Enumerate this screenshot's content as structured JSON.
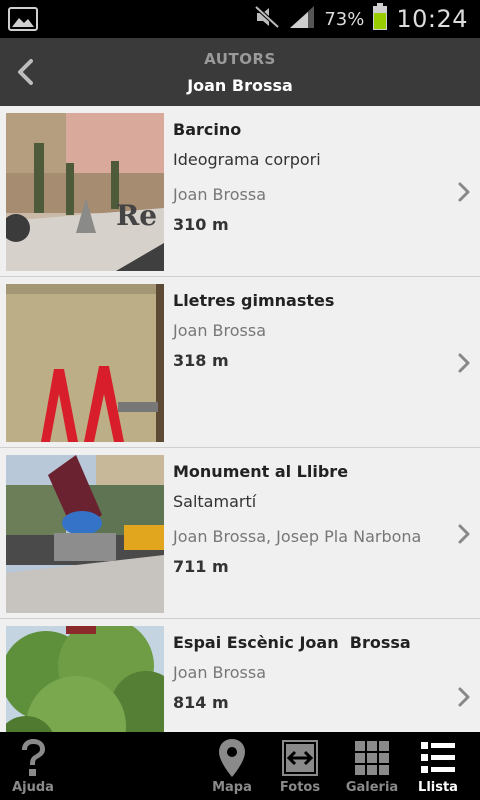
{
  "status_bar": {
    "battery_percent": "73%",
    "time": "10:24",
    "icons": [
      "image-icon",
      "mute-icon",
      "signal-icon",
      "battery-icon"
    ]
  },
  "header": {
    "subtitle": "AUTORS",
    "title": "Joan Brossa",
    "back_icon": "chevron-left-icon"
  },
  "items": [
    {
      "title": "Barcino",
      "subtitle": "Ideograma corpori",
      "author": "Joan Brossa",
      "distance": "310 m"
    },
    {
      "title": "Lletres gimnastes",
      "subtitle": "",
      "author": "Joan Brossa",
      "distance": "318 m"
    },
    {
      "title": "Monument al Llibre",
      "subtitle": "Saltamartí",
      "author": "Joan Brossa, Josep Pla Narbona",
      "distance": "711 m"
    },
    {
      "title": "Espai Escènic Joan  Brossa",
      "subtitle": "",
      "author": "Joan Brossa",
      "distance": "814 m"
    }
  ],
  "tabs": [
    {
      "label": "Ajuda",
      "icon": "help-icon"
    },
    {
      "label": "Mapa",
      "icon": "map-pin-icon"
    },
    {
      "label": "Fotos",
      "icon": "swap-arrows-icon"
    },
    {
      "label": "Galeria",
      "icon": "grid-icon"
    },
    {
      "label": "Llista",
      "icon": "list-icon",
      "active": true
    }
  ],
  "colors": {
    "header_bg": "#3a3a3a",
    "list_bg": "#f0f0f0",
    "tabbar_bg": "#000000",
    "battery_fill": "#99cc00"
  }
}
